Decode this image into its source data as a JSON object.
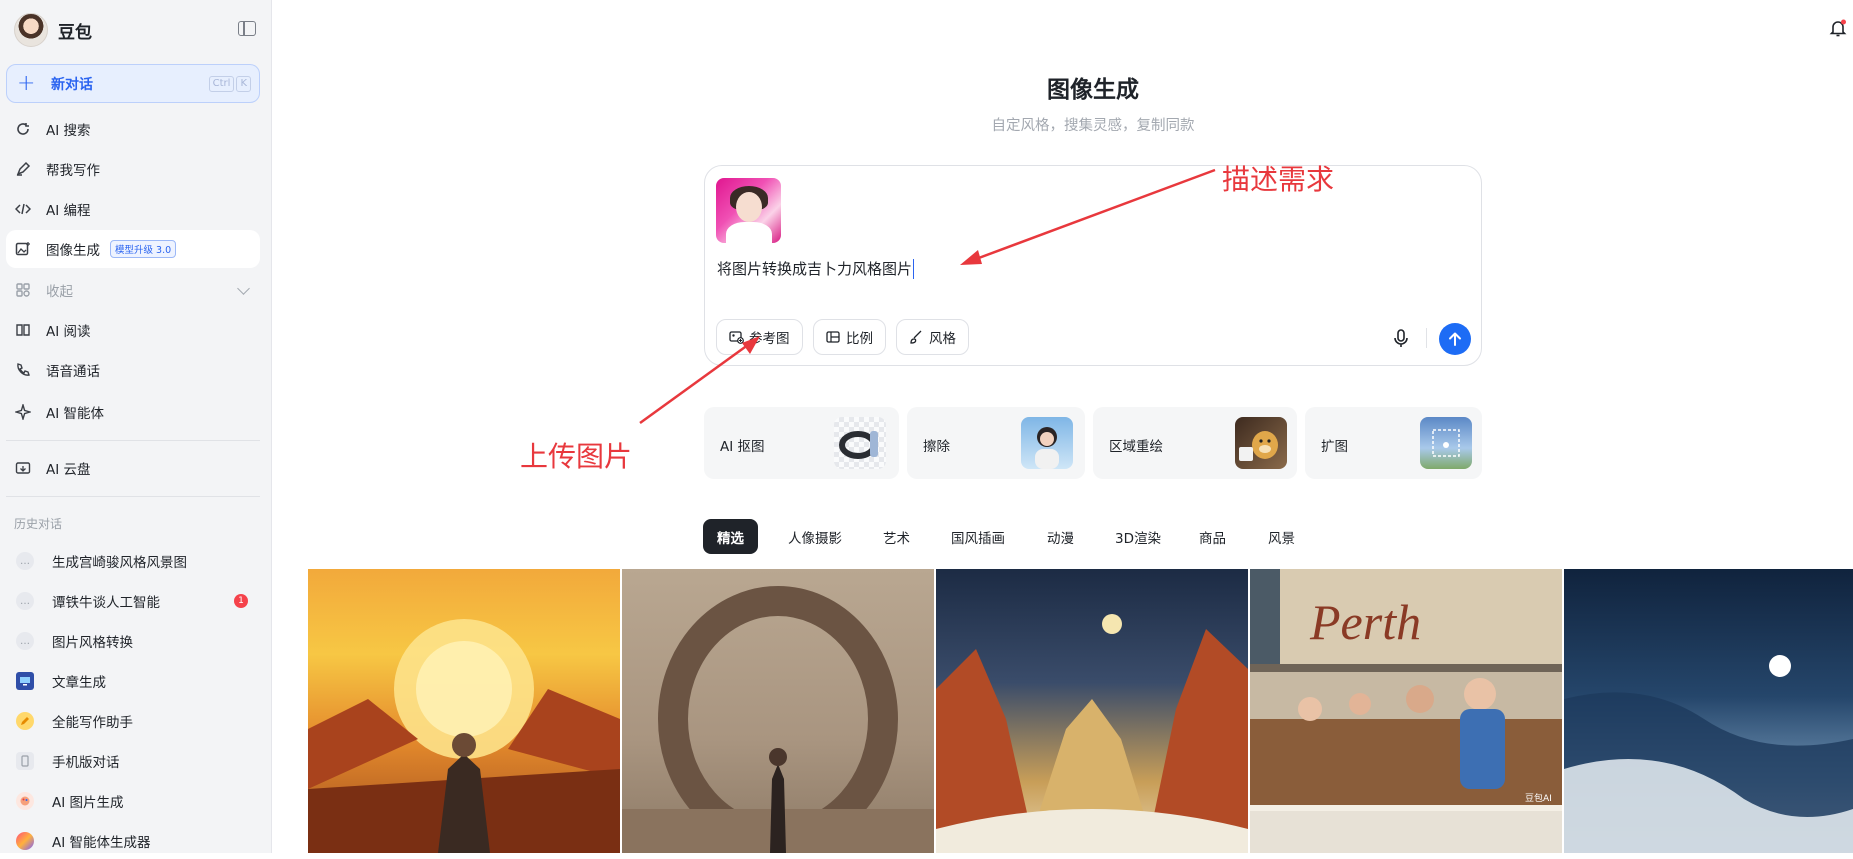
{
  "sidebar": {
    "brand_name": "豆包",
    "new_chat": {
      "label": "新对话",
      "shortcut": [
        "Ctrl",
        "K"
      ]
    },
    "nav": [
      {
        "label": "AI 搜索",
        "icon": "search-icon"
      },
      {
        "label": "帮我写作",
        "icon": "pen-icon"
      },
      {
        "label": "AI 编程",
        "icon": "code-icon"
      },
      {
        "label": "图像生成",
        "icon": "image-plus-icon",
        "badge": "模型升级 3.0",
        "active": true
      },
      {
        "label": "收起",
        "icon": "apps-icon",
        "muted": true
      },
      {
        "label": "AI 阅读",
        "icon": "book-icon"
      },
      {
        "label": "语音通话",
        "icon": "phone-icon"
      },
      {
        "label": "AI 智能体",
        "icon": "sparkle-icon"
      },
      {
        "label": "AI 云盘",
        "icon": "cloud-drive-icon"
      }
    ],
    "history_label": "历史对话",
    "history": [
      {
        "label": "生成宫崎骏风格风景图",
        "icon": "chat-bubble-icon"
      },
      {
        "label": "谭铁牛谈人工智能",
        "icon": "chat-bubble-icon",
        "unread": "1"
      },
      {
        "label": "图片风格转换",
        "icon": "chat-bubble-icon"
      },
      {
        "label": "文章生成",
        "icon": "monitor-icon"
      },
      {
        "label": "全能写作助手",
        "icon": "pencil-badge-icon"
      },
      {
        "label": "手机版对话",
        "icon": "phone-device-icon"
      },
      {
        "label": "AI 图片生成",
        "icon": "palette-icon"
      },
      {
        "label": "AI 智能体生成器",
        "icon": "gradient-orb-icon"
      }
    ]
  },
  "main": {
    "title": "图像生成",
    "subtitle": "自定风格，搜集灵感，复制同款",
    "composer": {
      "prompt": "将图片转换成吉卜力风格图片",
      "tools": [
        "参考图",
        "比例",
        "风格"
      ]
    },
    "skills": [
      "AI 抠图",
      "擦除",
      "区域重绘",
      "扩图"
    ],
    "categories": [
      "精选",
      "人像摄影",
      "艺术",
      "国风插画",
      "动漫",
      "3D渲染",
      "商品",
      "风景"
    ],
    "gallery_watermark": "豆包AI",
    "gallery_sign": "Perth"
  },
  "annotations": {
    "describe": "描述需求",
    "upload": "上传图片"
  },
  "colors": {
    "accent": "#1d6cf5",
    "annotation": "#e8383d",
    "unread": "#f5424b"
  }
}
